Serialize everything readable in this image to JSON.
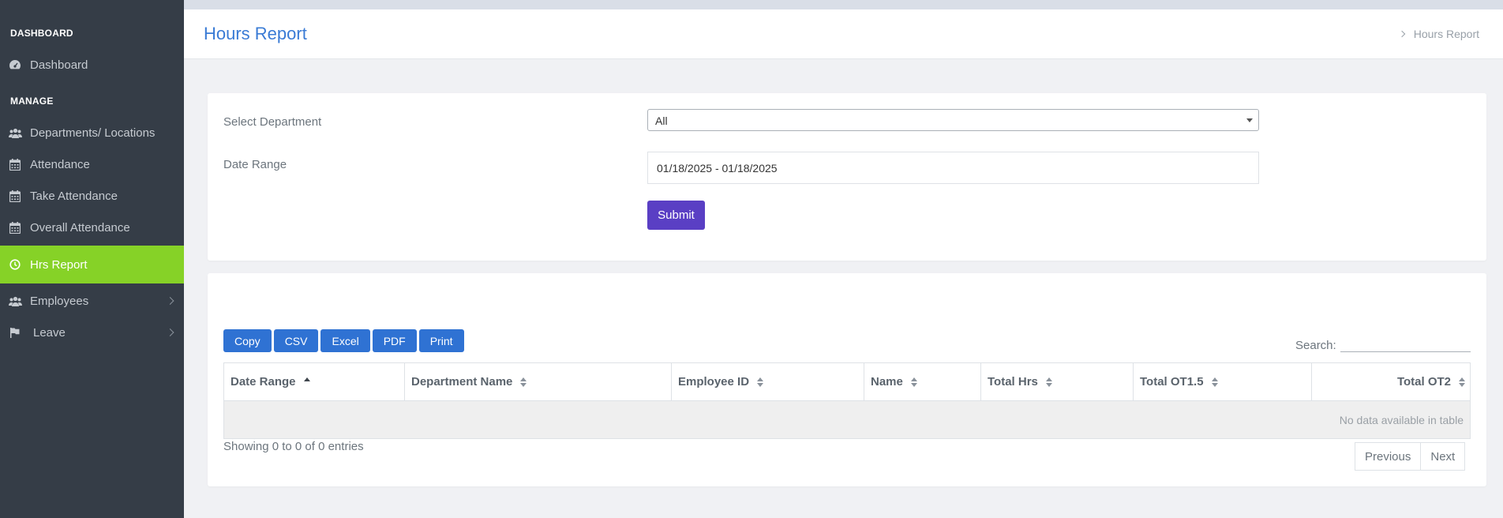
{
  "sidebar": {
    "sections": [
      "DASHBOARD",
      "MANAGE"
    ],
    "items": [
      {
        "label": "Dashboard",
        "icon": "dashboard-icon"
      },
      {
        "label": "Departments/ Locations",
        "icon": "users-icon"
      },
      {
        "label": "Attendance",
        "icon": "calendar-icon"
      },
      {
        "label": "Take Attendance",
        "icon": "calendar-icon"
      },
      {
        "label": "Overall Attendance",
        "icon": "calendar-icon"
      },
      {
        "label": "Hrs Report",
        "icon": "clock-icon",
        "active": true
      },
      {
        "label": "Employees",
        "icon": "users-icon"
      },
      {
        "label": "Leave",
        "icon": "flag-icon"
      }
    ],
    "active_color": "#86d227"
  },
  "header": {
    "title": "Hours Report",
    "breadcrumb": "Hours Report"
  },
  "filters": {
    "department_label": "Select Department",
    "department_value": "All",
    "date_label": "Date Range",
    "date_value": "01/18/2025 - 01/18/2025",
    "submit_label": "Submit"
  },
  "table_tools": {
    "buttons": [
      "Copy",
      "CSV",
      "Excel",
      "PDF",
      "Print"
    ],
    "search_label": "Search:"
  },
  "table": {
    "columns": [
      "Date Range",
      "Department Name",
      "Employee ID",
      "Name",
      "Total Hrs",
      "Total OT1.5",
      "Total OT2"
    ],
    "empty_text": "No data available in table",
    "info": "Showing 0 to 0 of 0 entries",
    "prev_label": "Previous",
    "next_label": "Next"
  },
  "colors": {
    "sidebar_bg": "#353d47",
    "accent_blue": "#2f72d3",
    "submit_purple": "#5a3fc4",
    "title_blue": "#3a7bd5"
  }
}
